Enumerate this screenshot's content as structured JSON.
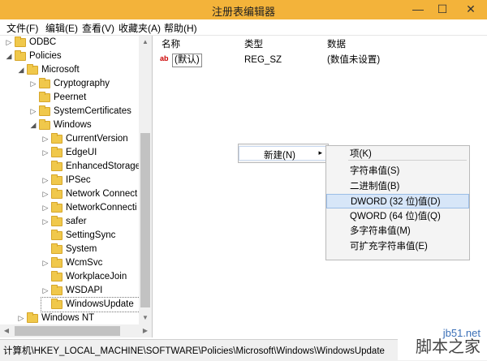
{
  "window": {
    "title": "注册表编辑器",
    "controls": {
      "min": "—",
      "max": "☐",
      "close": "✕"
    }
  },
  "menubar": [
    "文件(F)",
    "编辑(E)",
    "查看(V)",
    "收藏夹(A)",
    "帮助(H)"
  ],
  "tree": [
    {
      "label": "ODBC",
      "level": 0,
      "expander": "▷"
    },
    {
      "label": "Policies",
      "level": 0,
      "expander": "◢"
    },
    {
      "label": "Microsoft",
      "level": 1,
      "expander": "◢"
    },
    {
      "label": "Cryptography",
      "level": 2,
      "expander": "▷"
    },
    {
      "label": "Peernet",
      "level": 2,
      "expander": ""
    },
    {
      "label": "SystemCertificates",
      "level": 2,
      "expander": "▷"
    },
    {
      "label": "Windows",
      "level": 2,
      "expander": "◢"
    },
    {
      "label": "CurrentVersion",
      "level": 3,
      "expander": "▷"
    },
    {
      "label": "EdgeUI",
      "level": 3,
      "expander": "▷"
    },
    {
      "label": "EnhancedStorage",
      "level": 3,
      "expander": ""
    },
    {
      "label": "IPSec",
      "level": 3,
      "expander": "▷"
    },
    {
      "label": "Network Connect",
      "level": 3,
      "expander": "▷"
    },
    {
      "label": "NetworkConnecti",
      "level": 3,
      "expander": "▷"
    },
    {
      "label": "safer",
      "level": 3,
      "expander": "▷"
    },
    {
      "label": "SettingSync",
      "level": 3,
      "expander": ""
    },
    {
      "label": "System",
      "level": 3,
      "expander": ""
    },
    {
      "label": "WcmSvc",
      "level": 3,
      "expander": "▷"
    },
    {
      "label": "WorkplaceJoin",
      "level": 3,
      "expander": ""
    },
    {
      "label": "WSDAPI",
      "level": 3,
      "expander": "▷"
    },
    {
      "label": "WindowsUpdate",
      "level": 3,
      "expander": "",
      "selected": true
    },
    {
      "label": "Windows NT",
      "level": 1,
      "expander": "▷"
    }
  ],
  "list": {
    "headers": {
      "name": "名称",
      "type": "类型",
      "data": "数据"
    },
    "row": {
      "icon": "ab",
      "name": "(默认)",
      "type": "REG_SZ",
      "data": "(数值未设置)"
    }
  },
  "context_menu": {
    "new_label": "新建(N)",
    "submenu_arrow": "▸",
    "submenu": [
      {
        "label": "项(K)"
      },
      {
        "separator": true
      },
      {
        "label": "字符串值(S)"
      },
      {
        "label": "二进制值(B)"
      },
      {
        "label": "DWORD (32 位)值(D)",
        "highlight": true
      },
      {
        "label": "QWORD (64 位)值(Q)"
      },
      {
        "label": "多字符串值(M)"
      },
      {
        "label": "可扩充字符串值(E)"
      }
    ]
  },
  "statusbar": {
    "path": "计算机\\HKEY_LOCAL_MACHINE\\SOFTWARE\\Policies\\Microsoft\\Windows\\WindowsUpdate"
  },
  "watermark": {
    "site": "jb51.net",
    "text": "脚本之家"
  },
  "colors": {
    "titlebar": "#f3b33a",
    "folder": "#f0c84b",
    "highlight": "#d7e6f8"
  }
}
